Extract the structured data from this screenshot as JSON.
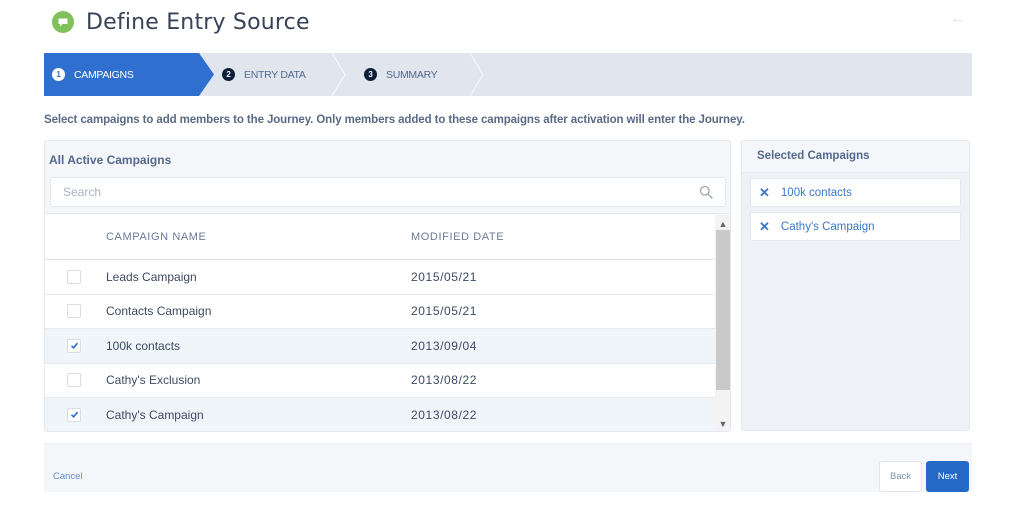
{
  "header": {
    "title": "Define Entry Source",
    "app_icon": "speech-bubble-icon",
    "back_icon": "left-arrow-icon"
  },
  "stepper": {
    "steps": [
      {
        "number": "1",
        "label": "CAMPAIGNS",
        "active": true
      },
      {
        "number": "2",
        "label": "ENTRY DATA",
        "active": false
      },
      {
        "number": "3",
        "label": "SUMMARY",
        "active": false
      }
    ]
  },
  "instruction": "Select campaigns to add members to the Journey. Only members added to these campaigns after activation will enter the Journey.",
  "all_campaigns": {
    "title": "All Active Campaigns",
    "search_placeholder": "Search",
    "search_value": "",
    "columns": [
      "CAMPAIGN NAME",
      "MODIFIED DATE"
    ],
    "rows": [
      {
        "name": "Leads Campaign",
        "date": "2015/05/21",
        "checked": false
      },
      {
        "name": "Contacts Campaign",
        "date": "2015/05/21",
        "checked": false
      },
      {
        "name": "100k contacts",
        "date": "2013/09/04",
        "checked": true
      },
      {
        "name": "Cathy's Exclusion",
        "date": "2013/08/22",
        "checked": false
      },
      {
        "name": "Cathy's Campaign",
        "date": "2013/08/22",
        "checked": true
      }
    ]
  },
  "selected_campaigns": {
    "title": "Selected Campaigns",
    "items": [
      {
        "label": "100k contacts"
      },
      {
        "label": "Cathy's Campaign"
      }
    ],
    "remove_symbol": "✕"
  },
  "footer": {
    "cancel_label": "Cancel",
    "back_label": "Back",
    "next_label": "Next"
  },
  "colors": {
    "accent": "#2e6fcf",
    "app_icon": "#7fc15a",
    "stepper_bg": "#e0e5ee",
    "selected_row": "#f0f5fa"
  }
}
